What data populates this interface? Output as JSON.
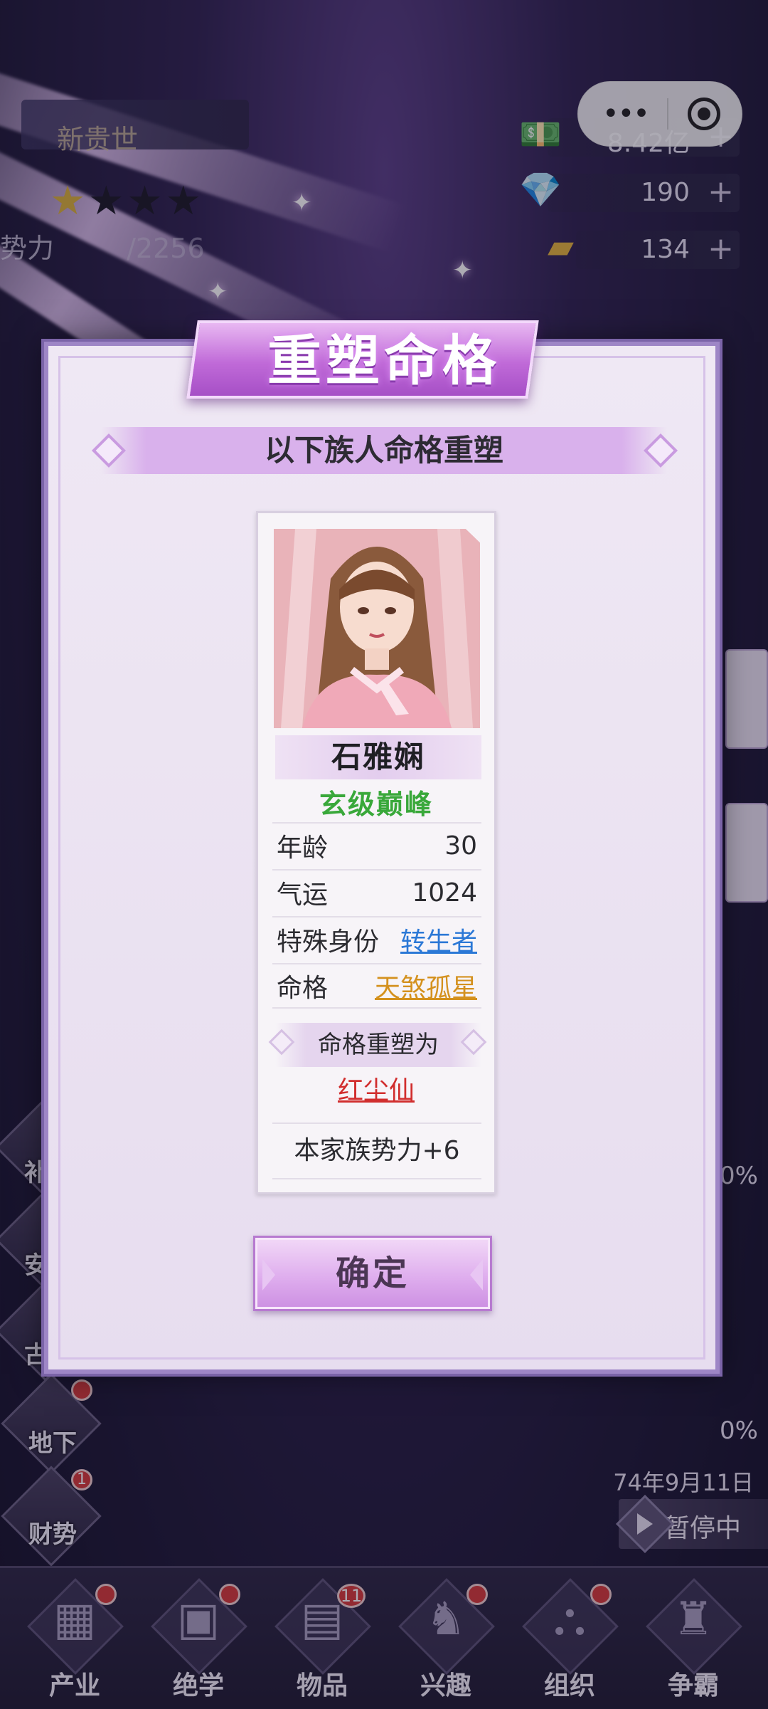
{
  "background": {
    "title_partial": "新贵世",
    "power_label": "势力",
    "power_value": "/2256",
    "resources": [
      {
        "icon": "money-icon",
        "value": "8.42亿"
      },
      {
        "icon": "gem-icon",
        "value": "190"
      },
      {
        "icon": "gold-bar-icon",
        "value": "134"
      }
    ],
    "side_buttons": [
      "补",
      "安",
      "古",
      "地下",
      "财势"
    ],
    "side_badge": "1",
    "right_percent_1": "0%",
    "right_percent_2": "0%",
    "date": "74年9月11日",
    "pause_label": "暂停中"
  },
  "bottom_nav": [
    {
      "label": "产业",
      "icon": "industry-icon",
      "glyph": "▦",
      "badge": ""
    },
    {
      "label": "绝学",
      "icon": "book-icon",
      "glyph": "▣",
      "badge": ""
    },
    {
      "label": "物品",
      "icon": "bag-icon",
      "glyph": "▤",
      "badge": "11"
    },
    {
      "label": "兴趣",
      "icon": "chess-knight-icon",
      "glyph": "♞",
      "badge": ""
    },
    {
      "label": "组织",
      "icon": "org-chart-icon",
      "glyph": "⛬",
      "badge": ""
    },
    {
      "label": "争霸",
      "icon": "throne-icon",
      "glyph": "♜",
      "badge": ""
    }
  ],
  "dialog": {
    "title": "重塑命格",
    "subtitle": "以下族人命格重塑",
    "member": {
      "name": "石雅娴",
      "rank": "玄级巅峰",
      "age_label": "年龄",
      "age_value": "30",
      "luck_label": "气运",
      "luck_value": "1024",
      "identity_label": "特殊身份",
      "identity_value": "转生者",
      "fate_label": "命格",
      "fate_value": "天煞孤星"
    },
    "reshape_label": "命格重塑为",
    "new_fate": "红尘仙",
    "bonus": "本家族势力+6",
    "confirm_label": "确定"
  },
  "colors": {
    "dialog_accent": "#c06ad8",
    "rank_green": "#39a83a",
    "identity_blue": "#2b78d6",
    "fate_gold": "#d4911e",
    "new_fate_red": "#d12e2e"
  }
}
